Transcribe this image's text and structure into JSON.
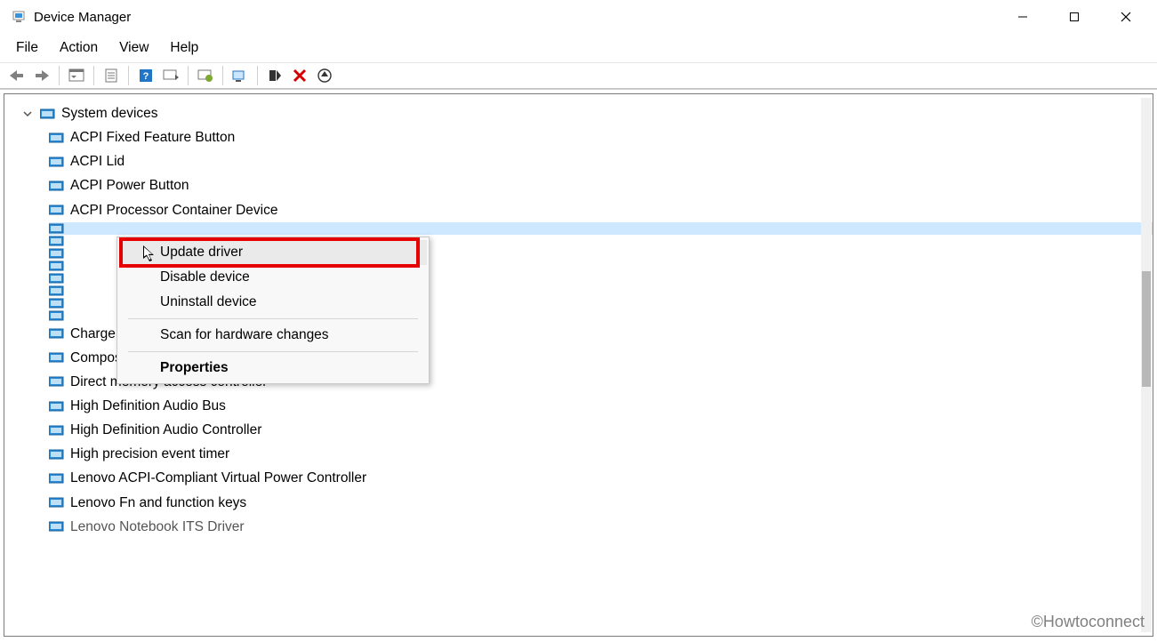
{
  "window": {
    "title": "Device Manager"
  },
  "menubar": {
    "file": "File",
    "action": "Action",
    "view": "View",
    "help": "Help"
  },
  "tree": {
    "category": "System devices",
    "items": [
      "ACPI Fixed Feature Button",
      "ACPI Lid",
      "ACPI Power Button",
      "ACPI Processor Container Device",
      "",
      "",
      "",
      "",
      "",
      "",
      "",
      "",
      "Charge Arbitration Driver",
      "Composite Bus Enumerator",
      "Direct memory access controller",
      "High Definition Audio Bus",
      "High Definition Audio Controller",
      "High precision event timer",
      "Lenovo ACPI-Compliant Virtual Power Controller",
      "Lenovo Fn and function keys",
      "Lenovo Notebook ITS Driver"
    ]
  },
  "context_menu": {
    "update": "Update driver",
    "disable": "Disable device",
    "uninstall": "Uninstall device",
    "scan": "Scan for hardware changes",
    "properties": "Properties"
  },
  "watermark": "©Howtoconnect"
}
